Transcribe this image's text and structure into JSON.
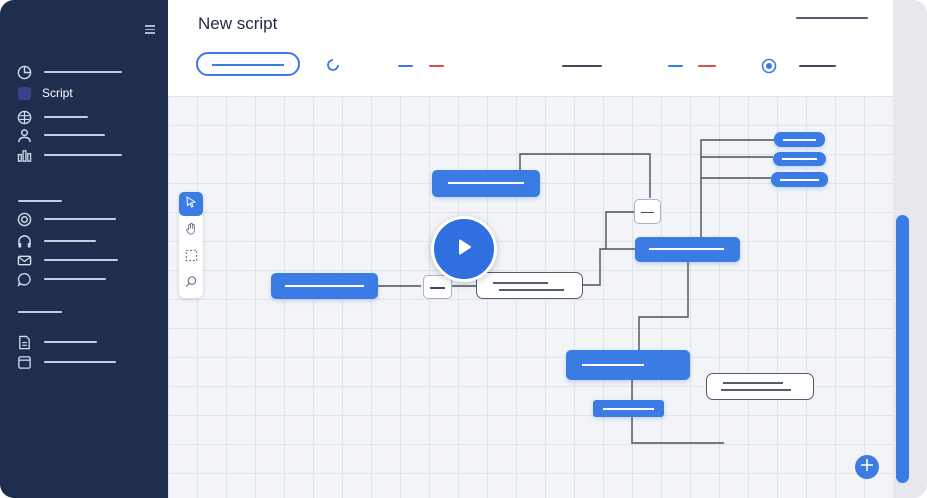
{
  "sidebar": {
    "items": [
      {
        "icon": "pie-chart-icon",
        "label": ""
      },
      {
        "icon": "script-icon",
        "label": "Script"
      },
      {
        "icon": "brain-icon",
        "label": ""
      },
      {
        "icon": "users-icon",
        "label": ""
      },
      {
        "icon": "bar-chart-icon",
        "label": ""
      },
      {
        "icon": "target-icon",
        "label": ""
      },
      {
        "icon": "headphones-icon",
        "label": ""
      },
      {
        "icon": "mail-icon",
        "label": ""
      },
      {
        "icon": "chat-icon",
        "label": ""
      },
      {
        "icon": "document-icon",
        "label": ""
      },
      {
        "icon": "archive-icon",
        "label": ""
      }
    ]
  },
  "header": {
    "title": "New script"
  },
  "colors": {
    "sidebar_bg": "#1f2d4f",
    "accent": "#3b7be4",
    "accent_dark": "#2f6fe0",
    "red_dash": "#d9534f"
  },
  "toolbar_tools": [
    "cursor-icon",
    "hand-icon",
    "select-box-icon",
    "search-icon"
  ],
  "overlay": {
    "icon": "play-icon"
  },
  "canvas_actions": {
    "add_icon": "plus-icon"
  }
}
